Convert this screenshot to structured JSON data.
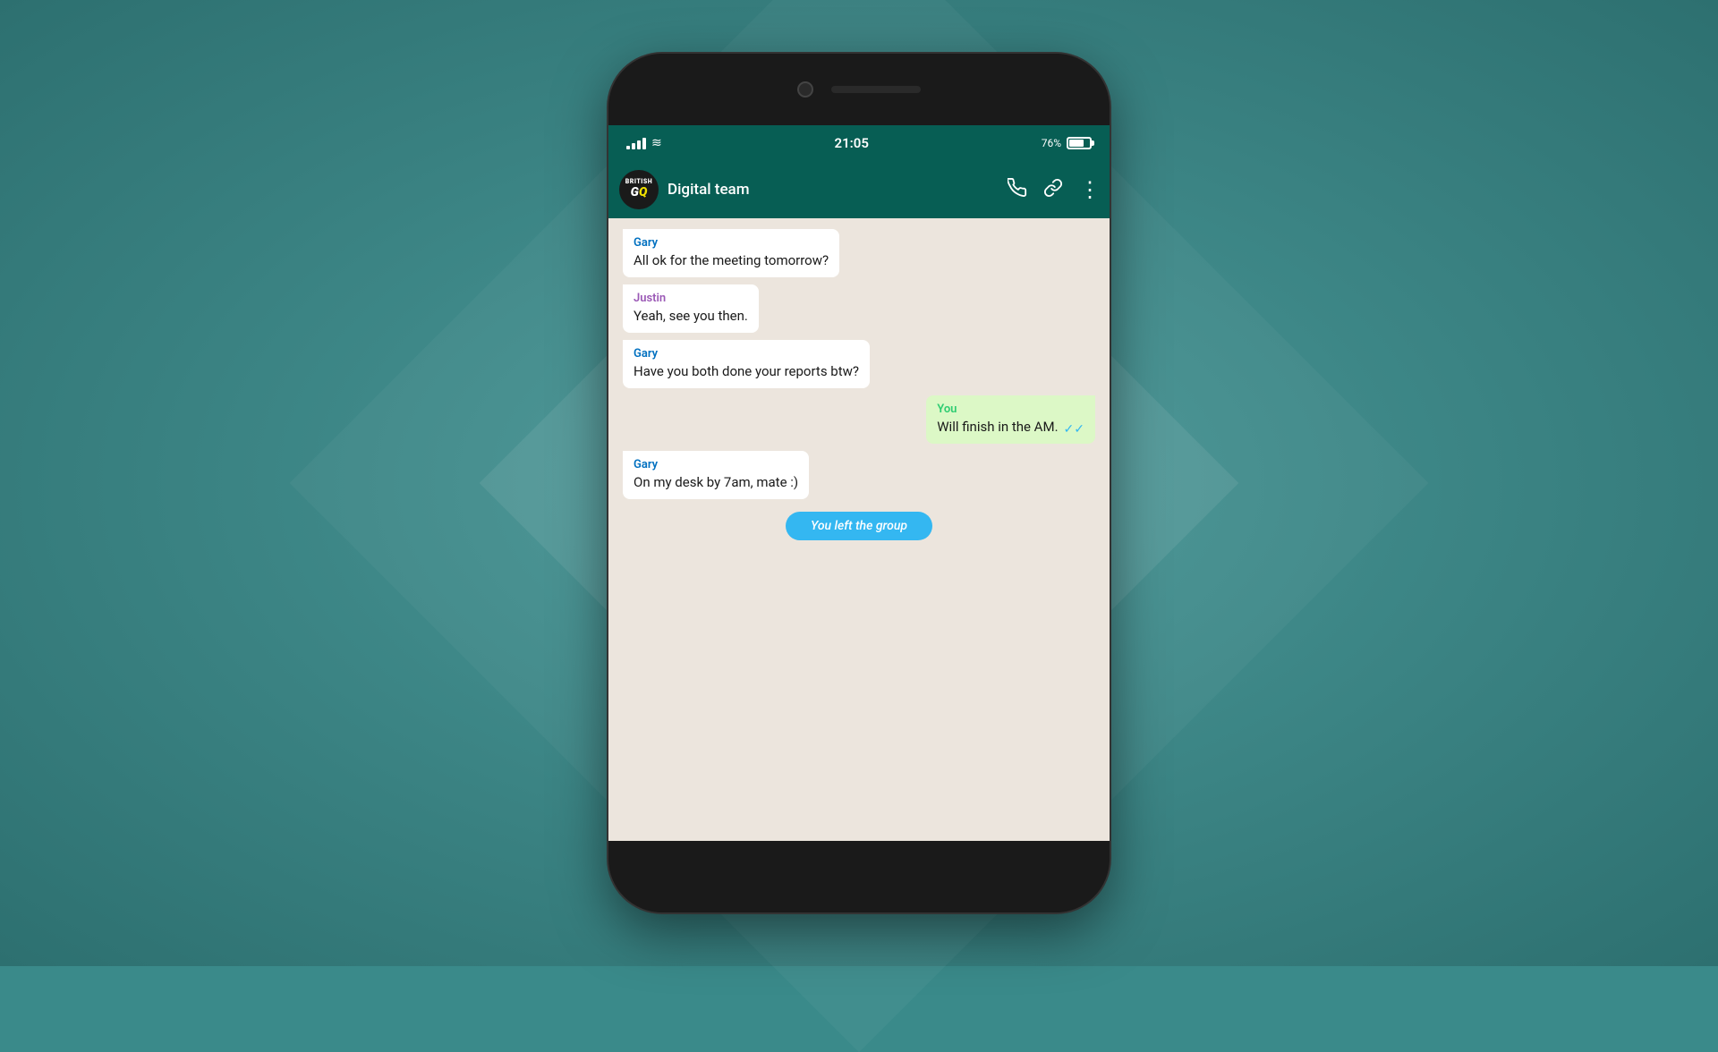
{
  "background": {
    "color": "#3a8a8a"
  },
  "phone": {
    "status_bar": {
      "time": "21:05",
      "battery_percent": "76%",
      "signal_label": "signal",
      "wifi_label": "wifi"
    },
    "chat_header": {
      "group_name": "Digital team",
      "avatar_brand_line1": "BRITISH",
      "avatar_brand_gq": "GQ",
      "call_icon": "📞",
      "video_icon": "🔗",
      "menu_icon": "⋮"
    },
    "messages": [
      {
        "id": "msg1",
        "type": "received",
        "sender": "Gary",
        "sender_class": "sender-gary",
        "text": "All ok for the meeting tomorrow?"
      },
      {
        "id": "msg2",
        "type": "received",
        "sender": "Justin",
        "sender_class": "sender-justin",
        "text": "Yeah, see you then."
      },
      {
        "id": "msg3",
        "type": "received",
        "sender": "Gary",
        "sender_class": "sender-gary",
        "text": "Have you both done your reports btw?"
      },
      {
        "id": "msg4",
        "type": "sent",
        "sender": "You",
        "sender_class": "sender-you",
        "text": "Will finish in the AM.",
        "has_ticks": true
      },
      {
        "id": "msg5",
        "type": "received",
        "sender": "Gary",
        "sender_class": "sender-gary",
        "text": "On my desk by 7am, mate :)"
      }
    ],
    "system_message": {
      "text": "You left the group"
    }
  }
}
